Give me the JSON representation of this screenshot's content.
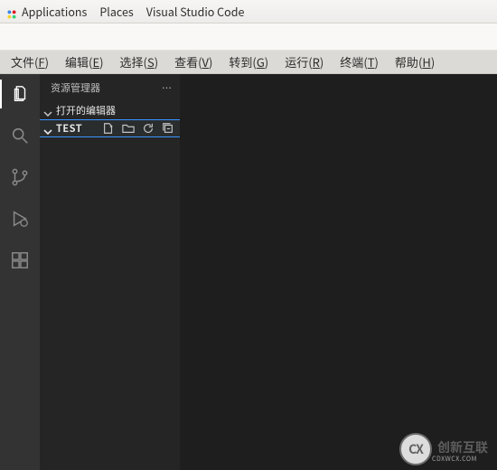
{
  "os": {
    "applications": "Applications",
    "places": "Places",
    "active_app": "Visual Studio Code"
  },
  "menu": {
    "file": {
      "label": "文件",
      "mn": "F"
    },
    "edit": {
      "label": "编辑",
      "mn": "E"
    },
    "select": {
      "label": "选择",
      "mn": "S"
    },
    "view": {
      "label": "查看",
      "mn": "V"
    },
    "go": {
      "label": "转到",
      "mn": "G"
    },
    "run": {
      "label": "运行",
      "mn": "R"
    },
    "terminal": {
      "label": "终端",
      "mn": "T"
    },
    "help": {
      "label": "帮助",
      "mn": "H"
    }
  },
  "sidebar": {
    "title": "资源管理器",
    "open_editors": "打开的编辑器",
    "folder_name": "TEST"
  },
  "watermark": {
    "mono": "CX",
    "brand": "创新互联",
    "sub": "CDXWCX.COM"
  }
}
